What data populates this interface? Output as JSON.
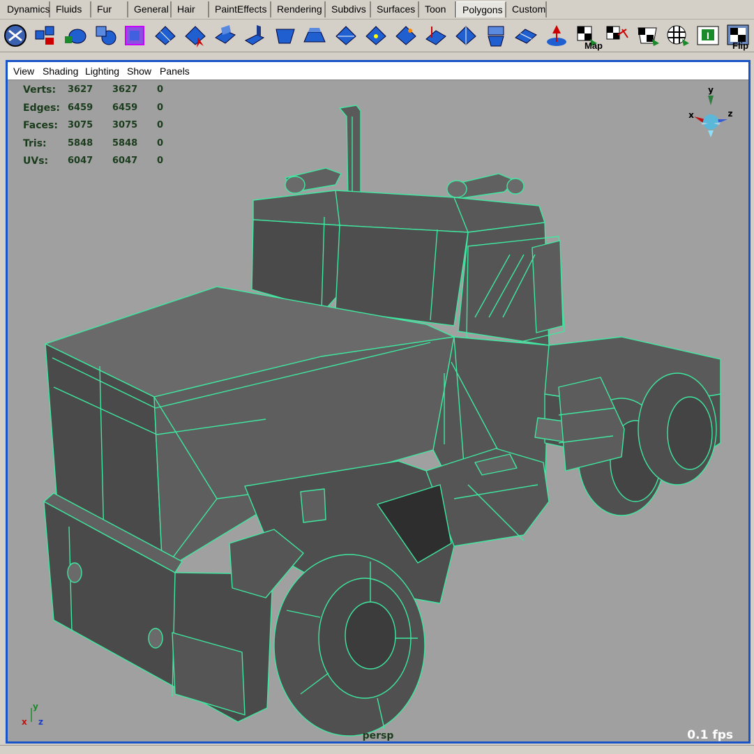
{
  "shelf_tabs": [
    {
      "label": "Dynamics",
      "active": false
    },
    {
      "label": "Fluids",
      "active": false
    },
    {
      "label": "Fur",
      "active": false
    },
    {
      "label": "General",
      "active": false
    },
    {
      "label": "Hair",
      "active": false
    },
    {
      "label": "PaintEffects",
      "active": false
    },
    {
      "label": "Rendering",
      "active": false
    },
    {
      "label": "Subdivs",
      "active": false
    },
    {
      "label": "Surfaces",
      "active": false
    },
    {
      "label": "Toon",
      "active": false
    },
    {
      "label": "Polygons",
      "active": true
    },
    {
      "label": "Custom",
      "active": false
    }
  ],
  "shelf_icons": [
    "polygon-select-icon",
    "extract-icon",
    "combine-icon",
    "separate-icon",
    "smooth-proxy-icon",
    "split-polygon-icon",
    "cut-faces-icon",
    "extrude-face-icon",
    "extrude-edge-icon",
    "bevel-icon",
    "wedge-face-icon",
    "poke-face-icon",
    "merge-vertices-icon",
    "append-polygon-icon",
    "bridge-icon",
    "duplicate-face-icon",
    "subdivide-icon",
    "sculpt-icon",
    "planar-map-icon",
    "map-uv-icon",
    "cylindrical-map-icon",
    "spherical-map-icon",
    "automatic-map-icon",
    "uv-editor-icon",
    "flip-uv-icon"
  ],
  "icon_overlays": {
    "map_text": "Map",
    "flip_text": "Flip"
  },
  "panel_menu": [
    "View",
    "Shading",
    "Lighting",
    "Show",
    "Panels"
  ],
  "hud": [
    {
      "label": "Verts:",
      "v1": "3627",
      "v2": "3627",
      "v3": "0"
    },
    {
      "label": "Edges:",
      "v1": "6459",
      "v2": "6459",
      "v3": "0"
    },
    {
      "label": "Faces:",
      "v1": "3075",
      "v2": "3075",
      "v3": "0"
    },
    {
      "label": "Tris:",
      "v1": "5848",
      "v2": "5848",
      "v3": "0"
    },
    {
      "label": "UVs:",
      "v1": "6047",
      "v2": "6047",
      "v3": "0"
    }
  ],
  "view_axis": {
    "x": "x",
    "y": "y",
    "z": "z"
  },
  "origin_axis": {
    "x": "x",
    "y": "y",
    "z": "z"
  },
  "camera_name": "persp",
  "fps": "0.1 fps",
  "colors": {
    "wireframe": "#3ee8a0",
    "viewport_bg": "#a0a0a0",
    "frame_border": "#1654c8",
    "hud_text": "#1a3c1c",
    "icon_blue": "#1f5fd0"
  }
}
